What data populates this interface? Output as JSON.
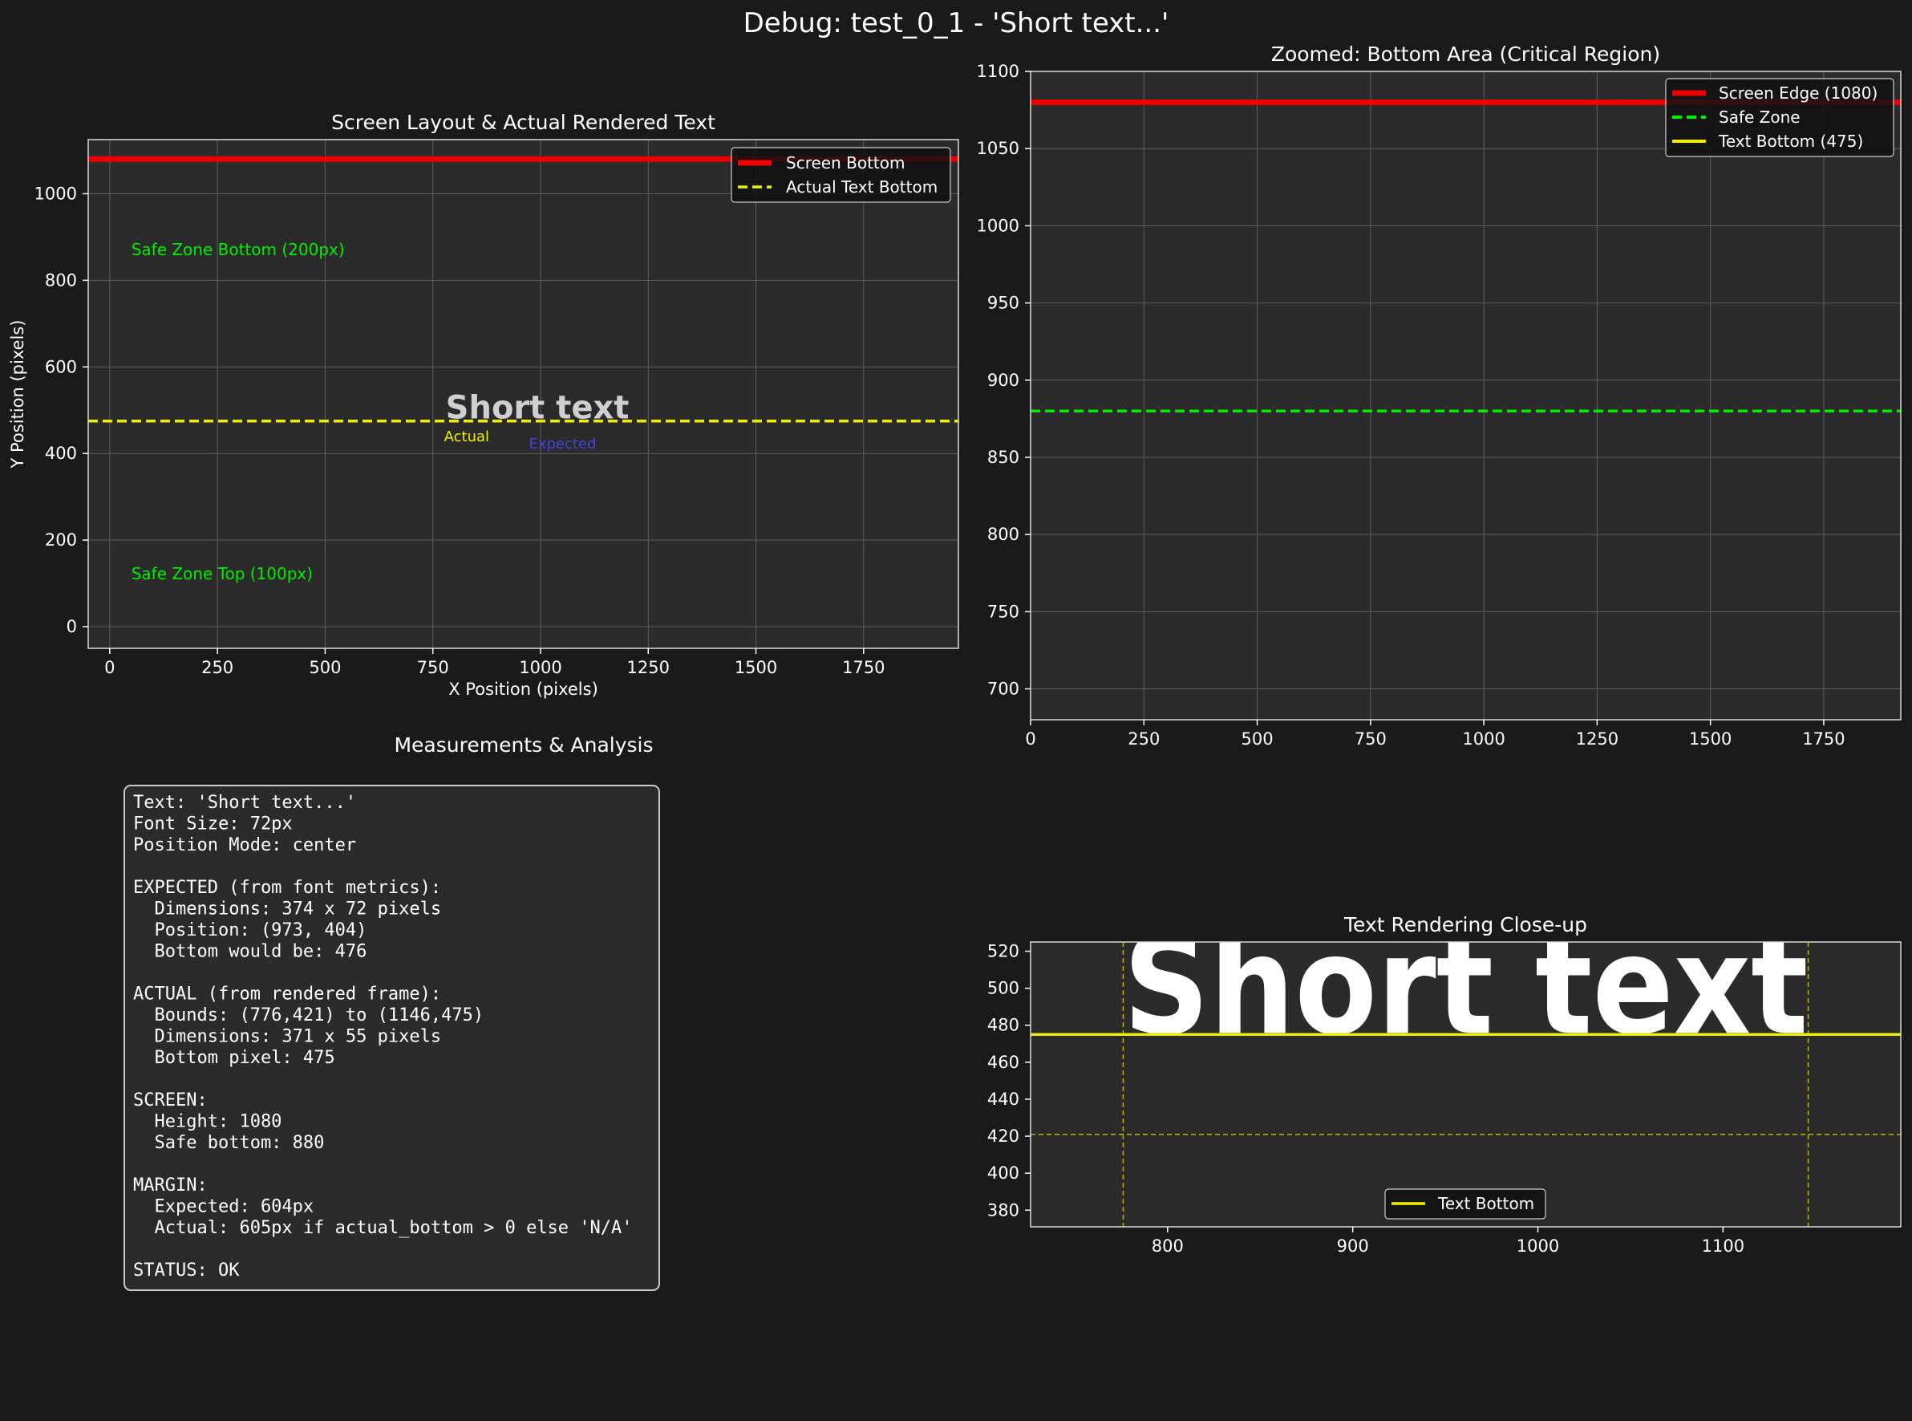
{
  "figure": {
    "title": "Debug: test_0_1 - 'Short text...'",
    "background": "#1a1a1a",
    "panel_bg": "#2b2b2b"
  },
  "chart_data": [
    {
      "type": "line",
      "id": "layout",
      "title": "Screen Layout & Actual Rendered Text",
      "xlabel": "X Position (pixels)",
      "ylabel": "Y Position (pixels)",
      "xlim": [
        -50,
        1970
      ],
      "ylim": [
        1125,
        -50
      ],
      "xticks": [
        0,
        250,
        500,
        750,
        1000,
        1250,
        1500,
        1750
      ],
      "yticks": [
        0,
        200,
        400,
        600,
        800,
        1000
      ],
      "grid": true,
      "screen_rect": {
        "x": [
          0,
          1920
        ],
        "y": [
          0,
          1080
        ],
        "color": "#ffffff"
      },
      "safe_zone": {
        "x": [
          0,
          1920
        ],
        "y": [
          100,
          880
        ],
        "color": "#00ee00"
      },
      "safe_top_label": "Safe Zone Top (100px)",
      "safe_bottom_label": "Safe Zone Bottom (200px)",
      "screen_bottom": {
        "y": 1080,
        "color": "#ee0000"
      },
      "text_bottom": {
        "y": 475,
        "color": "#eeee00"
      },
      "expected_box": {
        "x": [
          973,
          1347
        ],
        "y": [
          404,
          476
        ],
        "color": "#4444dd",
        "label": "Expected"
      },
      "actual_box": {
        "x": [
          776,
          1146
        ],
        "y": [
          421,
          475
        ],
        "color": "#eeee00",
        "label": "Actual"
      },
      "rendered_text": "Short text",
      "legend": {
        "position": "top-right",
        "items": [
          {
            "label": "Screen Bottom",
            "color": "#ee0000",
            "style": "solid"
          },
          {
            "label": "Actual Text Bottom",
            "color": "#eeee00",
            "style": "dashed"
          }
        ]
      }
    },
    {
      "type": "line",
      "id": "zoom",
      "title": "Zoomed: Bottom Area (Critical Region)",
      "xlim": [
        0,
        1920
      ],
      "ylim": [
        1100,
        680
      ],
      "xticks": [
        0,
        250,
        500,
        750,
        1000,
        1250,
        1500,
        1750
      ],
      "yticks": [
        700,
        750,
        800,
        850,
        900,
        950,
        1000,
        1050,
        1100
      ],
      "grid": true,
      "lines": [
        {
          "name": "Screen Edge (1080)",
          "y": 1080,
          "color": "#ee0000",
          "style": "solid"
        },
        {
          "name": "Safe Zone",
          "y": 880,
          "color": "#00ee00",
          "style": "dashed"
        },
        {
          "name": "Text Bottom (475)",
          "y": 475,
          "color": "#eeee00",
          "style": "solid"
        }
      ],
      "legend": {
        "position": "top-right"
      }
    },
    {
      "type": "line",
      "id": "closeup",
      "title": "Text Rendering Close-up",
      "xlim": [
        726,
        1196
      ],
      "ylim": [
        525,
        371
      ],
      "xticks": [
        800,
        900,
        1000,
        1100
      ],
      "yticks": [
        380,
        400,
        420,
        440,
        460,
        480,
        500,
        520
      ],
      "grid": false,
      "rendered_text": "Short text",
      "bounds": {
        "x": [
          776,
          1146
        ],
        "y": [
          421,
          475
        ]
      },
      "text_bottom": {
        "name": "Text Bottom",
        "y": 475,
        "color": "#eeee00"
      },
      "legend": {
        "position": "bottom-center"
      }
    }
  ],
  "analysis": {
    "title": "Measurements & Analysis",
    "lines": [
      "Text: 'Short text...'",
      "Font Size: 72px",
      "Position Mode: center",
      "",
      "EXPECTED (from font metrics):",
      "  Dimensions: 374 x 72 pixels",
      "  Position: (973, 404)",
      "  Bottom would be: 476",
      "",
      "ACTUAL (from rendered frame):",
      "  Bounds: (776,421) to (1146,475)",
      "  Dimensions: 371 x 55 pixels",
      "  Bottom pixel: 475",
      "",
      "SCREEN:",
      "  Height: 1080",
      "  Safe bottom: 880",
      "",
      "MARGIN:",
      "  Expected: 604px",
      "  Actual: 605px if actual_bottom > 0 else 'N/A'",
      "",
      "STATUS: OK"
    ]
  }
}
